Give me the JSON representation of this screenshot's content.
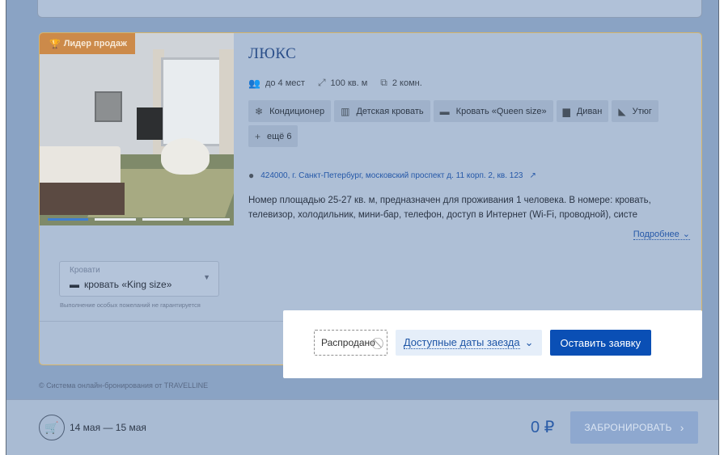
{
  "room": {
    "badge": "Лидер продаж",
    "title": "ЛЮКС",
    "specs": {
      "guests": "до 4 мест",
      "area": "100 кв. м",
      "rooms": "2 комн."
    },
    "amenities": [
      "Кондиционер",
      "Детская кровать",
      "Кровать «Queen size»",
      "Диван",
      "Утюг",
      "ещё 6"
    ],
    "address": "424000, г. Санкт-Петербург, московский проспект д. 11 корп. 2, кв. 123",
    "description": "Номер площадью 25-27 кв. м, предназначен для проживания 1 человека. В номере: кровать, телевизор, холодильник, мини-бар, телефон, доступ в Интернет (Wi-Fi, проводной), систе",
    "more_label": "Подробнее"
  },
  "beds": {
    "label": "Кровати",
    "value": "кровать «King size»",
    "note": "Выполнение особых пожеланий не гарантируется"
  },
  "actions": {
    "soldout": "Распродано",
    "dates": "Доступные даты заезда",
    "apply": "Оставить заявку"
  },
  "footer": {
    "powered": "Система онлайн-бронирования от TRAVELLINE",
    "dates": "14 мая — 15 мая",
    "price": "0 ₽",
    "book": "ЗАБРОНИРОВАТЬ"
  },
  "colors": {
    "primary": "#0a4fb5",
    "link": "#2558a8",
    "badge": "#cc8a4a"
  }
}
